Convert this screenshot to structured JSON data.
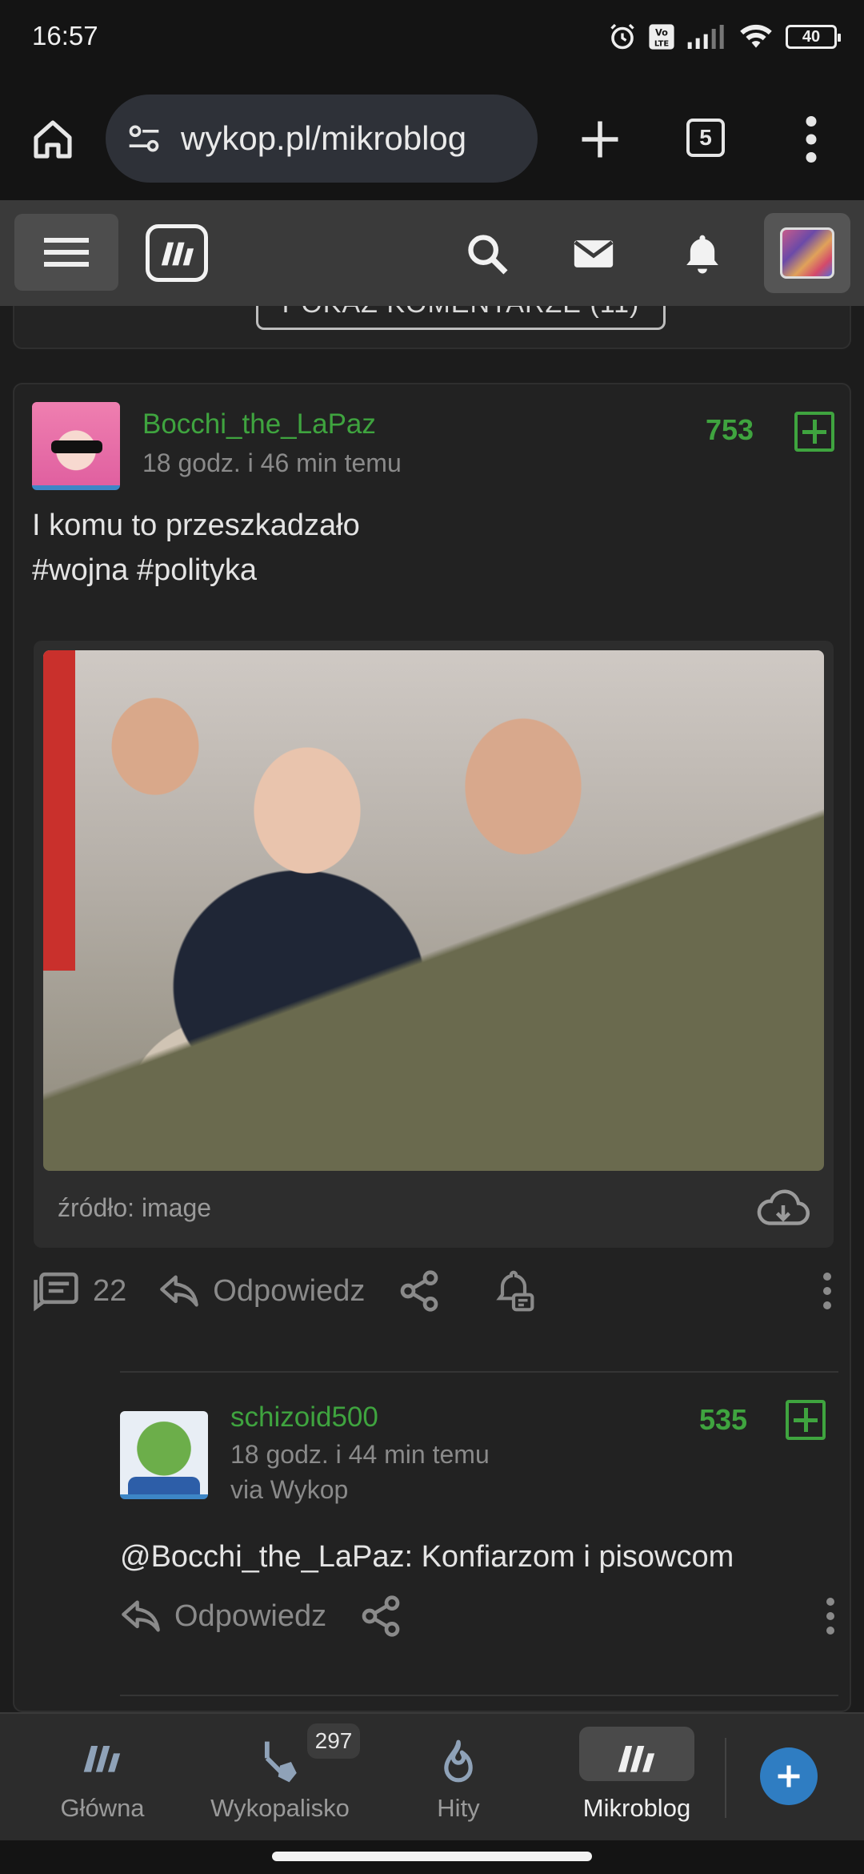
{
  "status_bar": {
    "time": "16:57",
    "battery": "40"
  },
  "browser": {
    "url": "wykop.pl/mikroblog",
    "tab_count": "5"
  },
  "previous_card": {
    "show_comments_label": "POKAŻ KOMENTARZE (11)"
  },
  "post": {
    "author": "Bocchi_the_LaPaz",
    "time": "18 godz. i 46 min temu",
    "score": "753",
    "text_line1": "I komu to przeszkadzało",
    "text_line2": "#wojna #polityka",
    "image_source": "źródło: image",
    "comments_count": "22",
    "reply_label": "Odpowiedz"
  },
  "comment": {
    "author": "schizoid500",
    "time": "18 godz. i 44 min temu",
    "via": "via Wykop",
    "score": "535",
    "text": "@Bocchi_the_LaPaz: Konfiarzom i pisowcom",
    "reply_label": "Odpowiedz"
  },
  "bottom_nav": {
    "items": [
      {
        "label": "Główna"
      },
      {
        "label": "Wykopalisko",
        "badge": "297"
      },
      {
        "label": "Hity"
      },
      {
        "label": "Mikroblog"
      }
    ]
  },
  "colors": {
    "accent_green": "#3fa43f",
    "fab_blue": "#2f7dc2"
  }
}
